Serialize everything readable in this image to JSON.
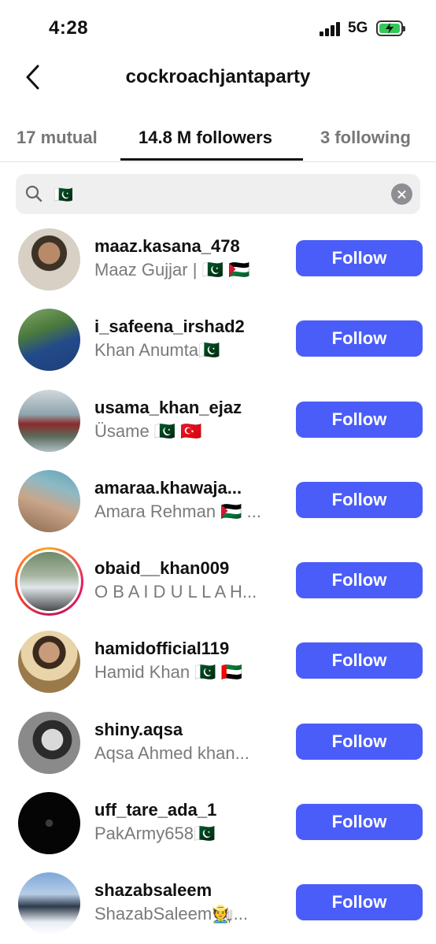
{
  "status_bar": {
    "time": "4:28",
    "network": "5G"
  },
  "header": {
    "title": "cockroachjantaparty"
  },
  "tabs": [
    {
      "label": "17 mutual"
    },
    {
      "label": "14.8 M followers"
    },
    {
      "label": "3 following"
    }
  ],
  "search": {
    "value": "🇵🇰"
  },
  "follow_label": "Follow",
  "users": [
    {
      "username": "maaz.kasana_478",
      "name": "Maaz Gujjar | 🇵🇰 🇵🇸",
      "button": "Follow"
    },
    {
      "username": "i_safeena_irshad2",
      "name": "Khan Anumta🇵🇰",
      "button": "Follow"
    },
    {
      "username": "usama_khan_ejaz",
      "name": "Üsame 🇵🇰  🇹🇷",
      "button": "Follow"
    },
    {
      "username": "amaraa.khawaja...",
      "name": "Amara Rehman 🇵🇸 ...",
      "button": "Follow"
    },
    {
      "username": "obaid__khan009",
      "name": "O B A I D U L L A H...",
      "button": "Follow"
    },
    {
      "username": "hamidofficial119",
      "name": "Hamid Khan 🇵🇰 🇦🇪",
      "button": "Follow"
    },
    {
      "username": "shiny.aqsa",
      "name": "Aqsa Ahmed khan...",
      "button": "Follow"
    },
    {
      "username": "uff_tare_ada_1",
      "name": "PakArmy658🇵🇰",
      "button": "Follow"
    },
    {
      "username": "shazabsaleem",
      "name": "ShazabSaleem🧑‍🌾...",
      "button": "Follow"
    }
  ]
}
